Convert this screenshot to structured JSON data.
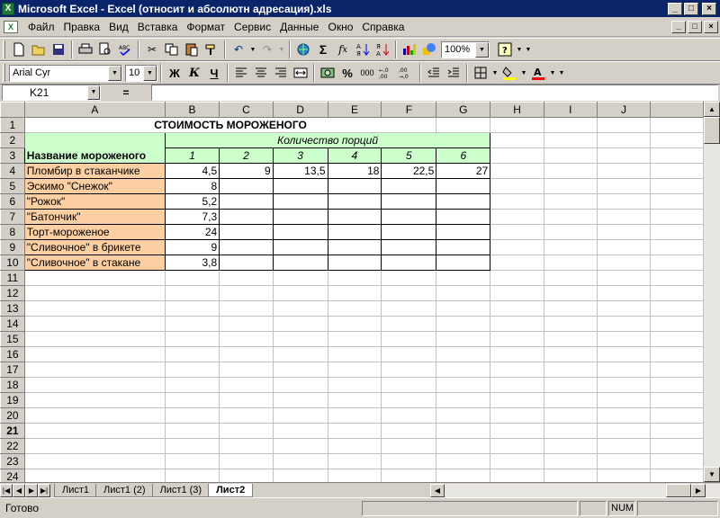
{
  "window": {
    "title": "Microsoft Excel - Excel (относит и абсолютн адресация).xls",
    "minimize": "_",
    "maximize": "□",
    "close": "×"
  },
  "menu": {
    "items": [
      "Файл",
      "Правка",
      "Вид",
      "Вставка",
      "Формат",
      "Сервис",
      "Данные",
      "Окно",
      "Справка"
    ],
    "mdi_min": "_",
    "mdi_max": "□",
    "mdi_close": "×"
  },
  "toolbar_std": {
    "zoom": "100%"
  },
  "toolbar_fmt": {
    "font": "Arial Cyr",
    "size": "10",
    "bold": "Ж",
    "italic": "К",
    "underline": "Ч",
    "percent": "%",
    "thousands": "000"
  },
  "formula_bar": {
    "name_box": "K21",
    "eq": "="
  },
  "columns": [
    "A",
    "B",
    "C",
    "D",
    "E",
    "F",
    "G",
    "H",
    "I",
    "J"
  ],
  "rows": [
    "1",
    "2",
    "3",
    "4",
    "5",
    "6",
    "7",
    "8",
    "9",
    "10",
    "11",
    "12",
    "13",
    "14",
    "15",
    "16",
    "17",
    "18",
    "19",
    "20",
    "21",
    "22",
    "23",
    "24"
  ],
  "active_row": "21",
  "sheet": {
    "title": "СТОИМОСТЬ МОРОЖЕНОГО",
    "qty_header": "Количество порций",
    "name_header": "Название мороженого",
    "qty": [
      "1",
      "2",
      "3",
      "4",
      "5",
      "6"
    ],
    "items": [
      {
        "name": "Пломбир в стаканчике",
        "price": "4,5",
        "values": [
          "9",
          "13,5",
          "18",
          "22,5",
          "27"
        ]
      },
      {
        "name": "Эскимо \"Снежок\"",
        "price": "8",
        "values": [
          "",
          "",
          "",
          "",
          ""
        ]
      },
      {
        "name": "\"Рожок\"",
        "price": "5,2",
        "values": [
          "",
          "",
          "",
          "",
          ""
        ]
      },
      {
        "name": "\"Батончик\"",
        "price": "7,3",
        "values": [
          "",
          "",
          "",
          "",
          ""
        ]
      },
      {
        "name": "Торт-мороженое",
        "price": "24",
        "values": [
          "",
          "",
          "",
          "",
          ""
        ]
      },
      {
        "name": "\"Сливочное\" в брикете",
        "price": "9",
        "values": [
          "",
          "",
          "",
          "",
          ""
        ]
      },
      {
        "name": "\"Сливочное\" в стакане",
        "price": "3,8",
        "values": [
          "",
          "",
          "",
          "",
          ""
        ]
      }
    ]
  },
  "tabs": [
    "Лист1",
    "Лист1 (2)",
    "Лист1 (3)",
    "Лист2"
  ],
  "active_tab": "Лист2",
  "status": {
    "text": "Готово",
    "num": "NUM"
  }
}
